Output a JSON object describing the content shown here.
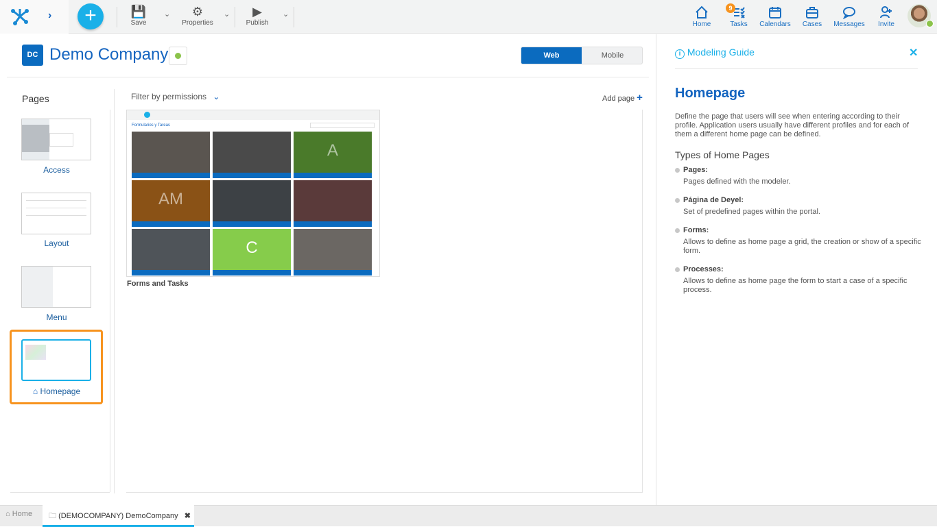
{
  "toolbar": {
    "save": "Save",
    "properties": "Properties",
    "publish": "Publish"
  },
  "nav": {
    "home": "Home",
    "tasks": "Tasks",
    "tasks_badge": "9",
    "calendars": "Calendars",
    "cases": "Cases",
    "messages": "Messages",
    "invite": "Invite"
  },
  "header": {
    "initials": "DC",
    "title": "Demo Company",
    "status_color": "#8bc34a",
    "web": "Web",
    "mobile": "Mobile"
  },
  "pages": {
    "title": "Pages",
    "items": [
      {
        "label": "Access"
      },
      {
        "label": "Layout"
      },
      {
        "label": "Menu"
      },
      {
        "label": "Homepage",
        "selected": true
      }
    ]
  },
  "content": {
    "filter": "Filter by permissions",
    "add_page": "Add page",
    "preview_title": "Formularios y Tareas",
    "preview_tiles": [
      "",
      "",
      "A",
      "AM",
      "",
      "",
      "",
      "C",
      ""
    ],
    "caption": "Forms and Tasks"
  },
  "guide": {
    "title": "Modeling Guide",
    "heading": "Homepage",
    "intro": "Define the page that users will see when entering according to their profile. Application users usually have different profiles and for each of them a different home page can be defined.",
    "subheading": "Types of Home Pages",
    "items": [
      {
        "term": "Pages:",
        "desc": "Pages defined with the modeler."
      },
      {
        "term": "Página de Deyel:",
        "desc": "Set of predefined pages within the portal."
      },
      {
        "term": "Forms:",
        "desc": "Allows to define as home page a grid, the creation or show of a specific form."
      },
      {
        "term": "Processes:",
        "desc": "Allows to define as home page the form to start a case of a specific process."
      }
    ]
  },
  "tabs": {
    "home": "Home",
    "active": "(DEMOCOMPANY) DemoCompany"
  },
  "colors": {
    "primary": "#0b6bbf",
    "accent": "#1ab0e8",
    "selected_border": "#f7931e"
  }
}
